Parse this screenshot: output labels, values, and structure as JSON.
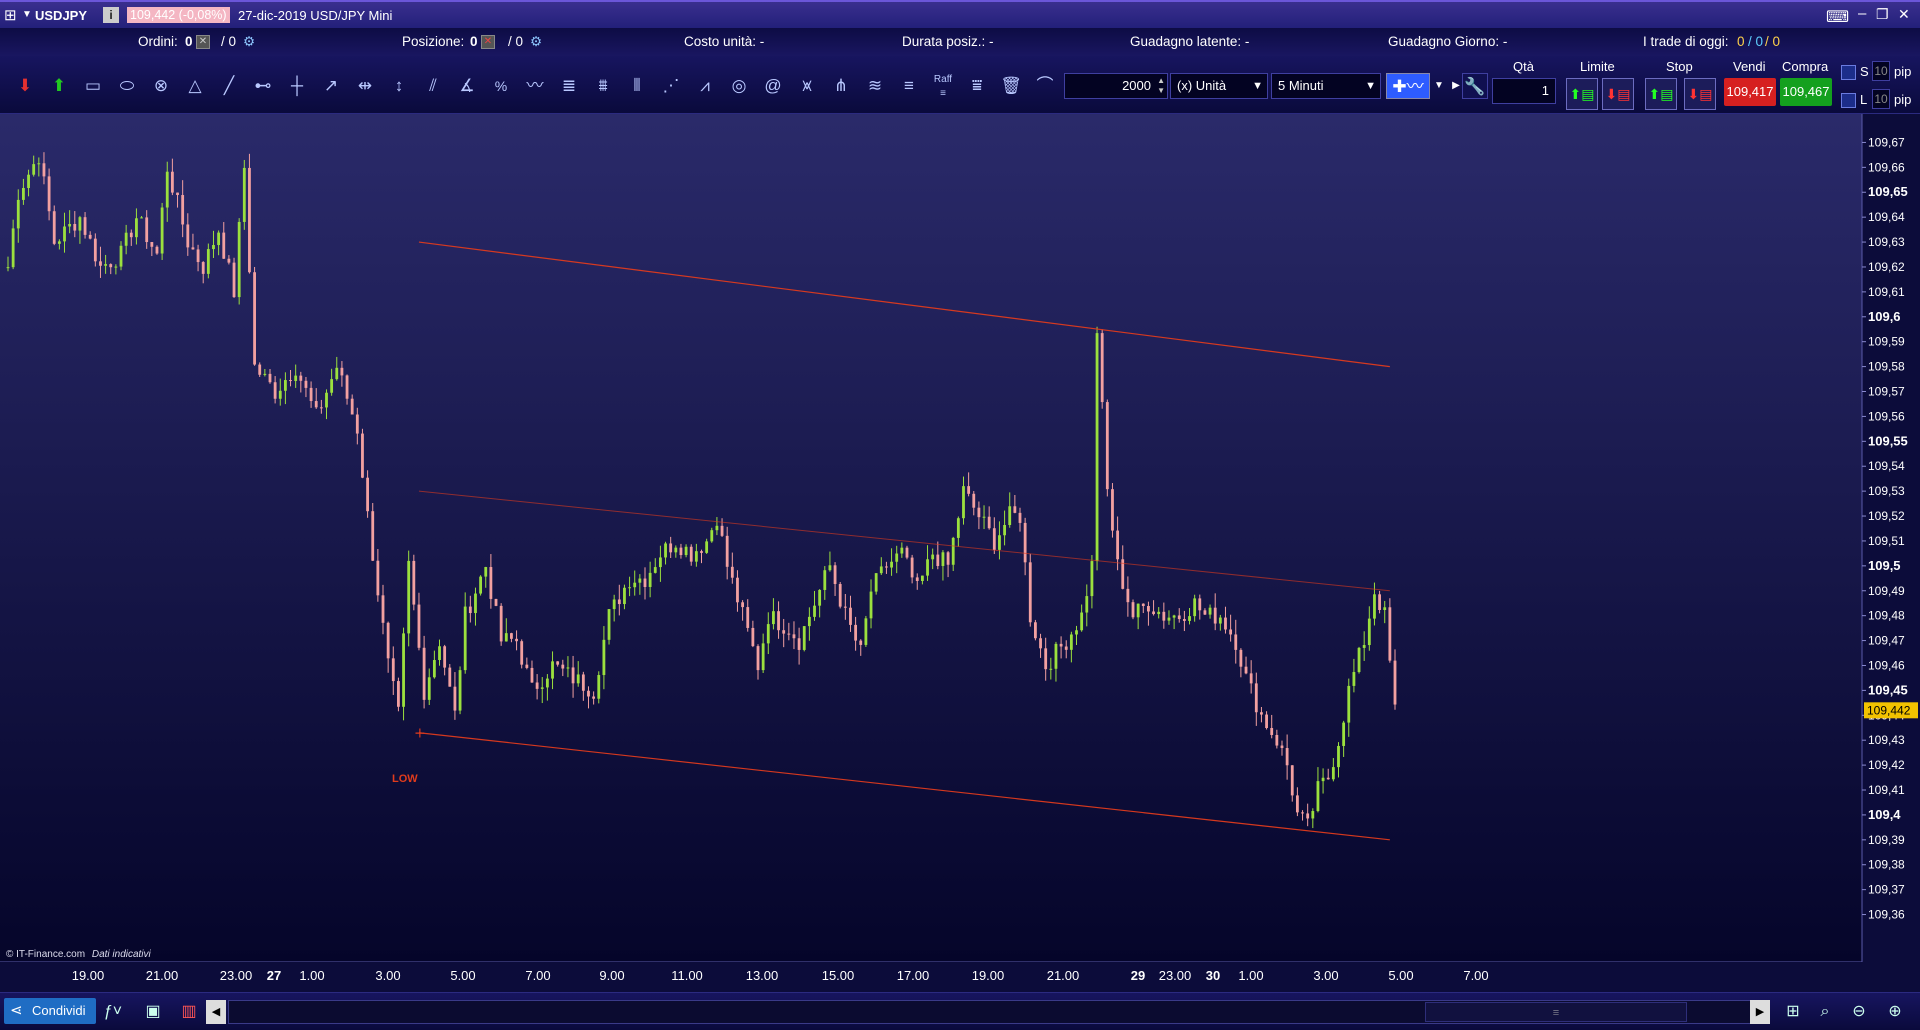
{
  "window": {
    "symbol": "USDJPY",
    "price_badge": "109,442 (-0,08%)",
    "title": "27-dic-2019 USD/JPY Mini"
  },
  "orders_bar": {
    "orders_label": "Ordini:",
    "orders_value": "0",
    "orders_value2": "/ 0",
    "position_label": "Posizione:",
    "position_value": "0",
    "position_value2": "/ 0",
    "unit_cost": "Costo unità: -",
    "duration": "Durata posiz.: -",
    "latent_gain": "Guadagno latente: -",
    "day_gain": "Guadagno Giorno: -",
    "trades_today_label": "I trade di oggi:",
    "trades_today_a": "0",
    "trades_today_b": "/ 0",
    "trades_today_c": "/ 0"
  },
  "toolbar": {
    "quantity_value": "2000",
    "unit_select": "(x) Unità",
    "timeframe_select": "5 Minuti",
    "qty_label": "Qtà",
    "qty_value": "1",
    "limit_label": "Limite",
    "stop_label": "Stop",
    "sell_label": "Vendi",
    "buy_label": "Compra",
    "sell_price": "109,417",
    "buy_price": "109,467",
    "s_label": "S",
    "l_label": "L",
    "s_pips": "10",
    "l_pips": "10",
    "pip_label": "pip",
    "pip_label2": "pip",
    "raff_label": "Raff",
    "sell_color": "#d62020",
    "buy_color": "#14a01e"
  },
  "chart_data": {
    "type": "candlestick",
    "symbol": "USDJPY",
    "interval": "5 Minuti",
    "y_ticks": [
      "109,67",
      "109,66",
      "109,65",
      "109,64",
      "109,63",
      "109,62",
      "109,61",
      "109,6",
      "109,59",
      "109,58",
      "109,57",
      "109,56",
      "109,55",
      "109,54",
      "109,53",
      "109,52",
      "109,51",
      "109,5",
      "109,49",
      "109,48",
      "109,47",
      "109,46",
      "109,45",
      "109,44",
      "109,43",
      "109,42",
      "109,41",
      "109,4",
      "109,39",
      "109,38",
      "109,37",
      "109,36"
    ],
    "bold_ticks": [
      "109,65",
      "109,6",
      "109,55",
      "109,5",
      "109,45",
      "109,4"
    ],
    "ylim": [
      109.355,
      109.677
    ],
    "x_ticks": [
      "19.00",
      "21.00",
      "23.00",
      "27",
      "1.00",
      "3.00",
      "5.00",
      "7.00",
      "9.00",
      "11.00",
      "13.00",
      "15.00",
      "17.00",
      "19.00",
      "21.00",
      "29",
      "23.00",
      "30",
      "1.00",
      "3.00",
      "5.00",
      "7.00"
    ],
    "bold_x_ticks": [
      "27",
      "29",
      "30"
    ],
    "last_price": "109,442",
    "last_price_color": "#f2c200",
    "up_color": "#9be03e",
    "down_color": "#f2a0a0",
    "channel_color": "#e03b1c",
    "low_label": "LOW",
    "credit": "© IT-Finance.com",
    "credit_note": "Dati indicativi",
    "anchors": [
      [
        0,
        109.62
      ],
      [
        2,
        109.65
      ],
      [
        6,
        109.665
      ],
      [
        9,
        109.63
      ],
      [
        14,
        109.64
      ],
      [
        18,
        109.62
      ],
      [
        22,
        109.625
      ],
      [
        25,
        109.64
      ],
      [
        29,
        109.625
      ],
      [
        31,
        109.66
      ],
      [
        35,
        109.63
      ],
      [
        38,
        109.62
      ],
      [
        41,
        109.635
      ],
      [
        44,
        109.61
      ],
      [
        46,
        109.66
      ],
      [
        48,
        109.58
      ],
      [
        52,
        109.57
      ],
      [
        56,
        109.58
      ],
      [
        60,
        109.56
      ],
      [
        64,
        109.58
      ],
      [
        68,
        109.555
      ],
      [
        70,
        109.52
      ],
      [
        72,
        109.49
      ],
      [
        74,
        109.46
      ],
      [
        76,
        109.44
      ],
      [
        78,
        109.5
      ],
      [
        81,
        109.45
      ],
      [
        84,
        109.47
      ],
      [
        87,
        109.44
      ],
      [
        89,
        109.48
      ],
      [
        93,
        109.5
      ],
      [
        96,
        109.47
      ],
      [
        99,
        109.47
      ],
      [
        102,
        109.45
      ],
      [
        106,
        109.46
      ],
      [
        110,
        109.455
      ],
      [
        114,
        109.45
      ],
      [
        117,
        109.48
      ],
      [
        121,
        109.495
      ],
      [
        124,
        109.495
      ],
      [
        127,
        109.505
      ],
      [
        130,
        109.51
      ],
      [
        133,
        109.505
      ],
      [
        136,
        109.51
      ],
      [
        138,
        109.52
      ],
      [
        140,
        109.5
      ],
      [
        143,
        109.48
      ],
      [
        146,
        109.46
      ],
      [
        148,
        109.48
      ],
      [
        152,
        109.475
      ],
      [
        154,
        109.47
      ],
      [
        156,
        109.48
      ],
      [
        160,
        109.5
      ],
      [
        163,
        109.48
      ],
      [
        166,
        109.465
      ],
      [
        168,
        109.49
      ],
      [
        171,
        109.5
      ],
      [
        174,
        109.505
      ],
      [
        177,
        109.49
      ],
      [
        180,
        109.505
      ],
      [
        183,
        109.5
      ],
      [
        186,
        109.53
      ],
      [
        189,
        109.52
      ],
      [
        192,
        109.51
      ],
      [
        195,
        109.52
      ],
      [
        197,
        109.52
      ],
      [
        199,
        109.48
      ],
      [
        202,
        109.46
      ],
      [
        206,
        109.47
      ],
      [
        209,
        109.48
      ],
      [
        211,
        109.5
      ],
      [
        212,
        109.595
      ],
      [
        214,
        109.53
      ],
      [
        216,
        109.5
      ],
      [
        219,
        109.48
      ],
      [
        222,
        109.485
      ],
      [
        225,
        109.48
      ],
      [
        228,
        109.48
      ],
      [
        231,
        109.485
      ],
      [
        233,
        109.48
      ],
      [
        236,
        109.48
      ],
      [
        239,
        109.47
      ],
      [
        241,
        109.455
      ],
      [
        244,
        109.44
      ],
      [
        247,
        109.43
      ],
      [
        249,
        109.42
      ],
      [
        251,
        109.4
      ],
      [
        253,
        109.395
      ],
      [
        255,
        109.41
      ],
      [
        257,
        109.415
      ],
      [
        259,
        109.43
      ],
      [
        261,
        109.45
      ],
      [
        264,
        109.47
      ],
      [
        266,
        109.49
      ],
      [
        268,
        109.48
      ],
      [
        270,
        109.442
      ]
    ],
    "channel": {
      "upper": [
        [
          80,
          109.63
        ],
        [
          212,
          109.6
        ],
        [
          269,
          109.58
        ]
      ],
      "middle": [
        [
          80,
          109.53
        ],
        [
          269,
          109.49
        ]
      ],
      "lower": [
        [
          80,
          109.433
        ],
        [
          269,
          109.39
        ]
      ]
    }
  },
  "bottombar": {
    "share_label": "Condividi",
    "scroll_grip": "≡"
  }
}
